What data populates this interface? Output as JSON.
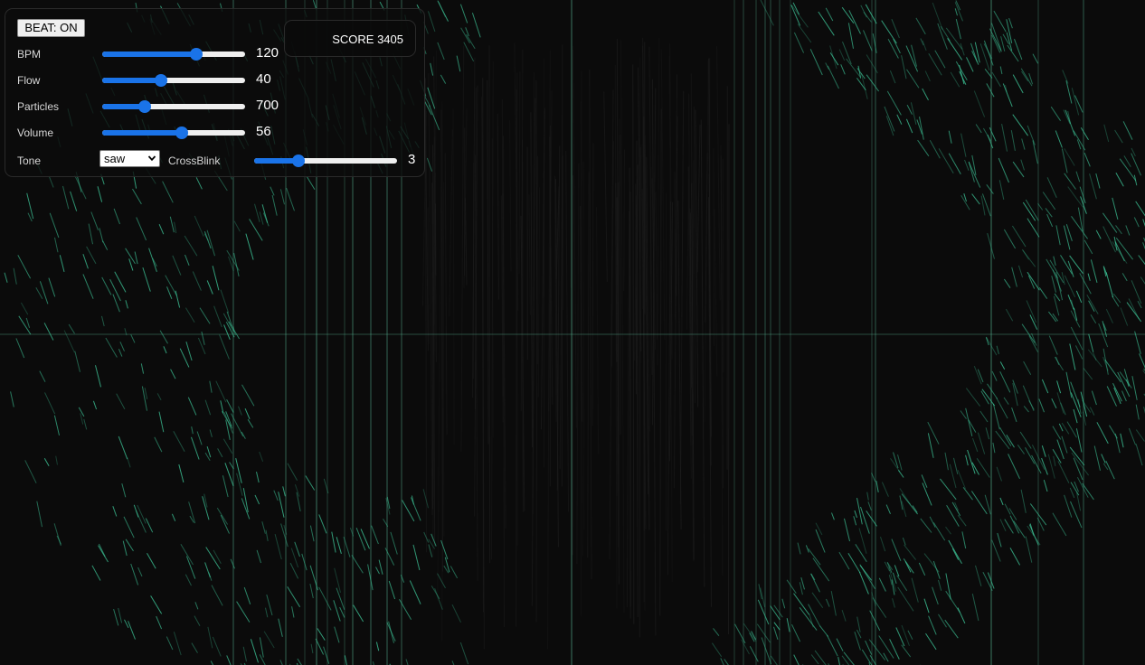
{
  "beat_button": {
    "label": "BEAT: ON"
  },
  "score": {
    "text": "SCORE 3405"
  },
  "controls": [
    {
      "label": "BPM",
      "value": "120",
      "fraction": 0.66
    },
    {
      "label": "Flow",
      "value": "40",
      "fraction": 0.41
    },
    {
      "label": "Particles",
      "value": "700",
      "fraction": 0.3
    },
    {
      "label": "Volume",
      "value": "56",
      "fraction": 0.56
    }
  ],
  "tone": {
    "label": "Tone",
    "selected": "saw"
  },
  "crossblink": {
    "label": "CrossBlink",
    "value": "3",
    "fraction": 0.31
  },
  "colors": {
    "background": "#0b0b0b",
    "accent": "#1a73e8",
    "particle": "#3ec89a",
    "line": "#5ec4a0"
  },
  "icons": {
    "select_arrow": "chevron-down-icon"
  }
}
